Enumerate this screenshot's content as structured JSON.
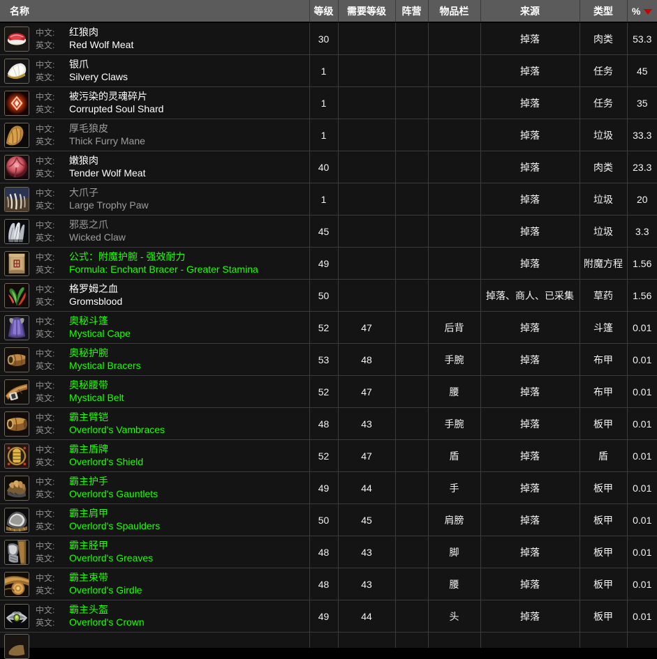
{
  "table": {
    "columns": [
      {
        "key": "name",
        "label": "名称"
      },
      {
        "key": "level",
        "label": "等级"
      },
      {
        "key": "req",
        "label": "需要等级"
      },
      {
        "key": "faction",
        "label": "阵营"
      },
      {
        "key": "slot",
        "label": "物品栏"
      },
      {
        "key": "source",
        "label": "来源"
      },
      {
        "key": "type",
        "label": "类型"
      },
      {
        "key": "pct",
        "label": "%"
      }
    ],
    "sort": {
      "column": "%",
      "direction": "desc",
      "caret_color": "#cc0000"
    },
    "labels": {
      "zh": "中文:",
      "en": "英文:"
    },
    "quality_colors": {
      "common": "#ffffff",
      "poor": "#9d9d9d",
      "uncommon": "#1eff00"
    },
    "rows": [
      {
        "zh": "红狼肉",
        "en": "Red Wolf Meat",
        "quality": "common",
        "level": "30",
        "req": "",
        "faction": "",
        "slot": "",
        "source": "掉落",
        "type": "肉类",
        "pct": "53.3",
        "icon": "red-wolf-meat-icon"
      },
      {
        "zh": "银爪",
        "en": "Silvery Claws",
        "quality": "common",
        "level": "1",
        "req": "",
        "faction": "",
        "slot": "",
        "source": "掉落",
        "type": "任务",
        "pct": "45",
        "icon": "silvery-claws-icon"
      },
      {
        "zh": "被污染的灵魂碎片",
        "en": "Corrupted Soul Shard",
        "quality": "common",
        "level": "1",
        "req": "",
        "faction": "",
        "slot": "",
        "source": "掉落",
        "type": "任务",
        "pct": "35",
        "icon": "corrupted-soul-shard-icon"
      },
      {
        "zh": "厚毛狼皮",
        "en": "Thick Furry Mane",
        "quality": "poor",
        "level": "1",
        "req": "",
        "faction": "",
        "slot": "",
        "source": "掉落",
        "type": "垃圾",
        "pct": "33.3",
        "icon": "thick-furry-mane-icon"
      },
      {
        "zh": "嫩狼肉",
        "en": "Tender Wolf Meat",
        "quality": "common",
        "level": "40",
        "req": "",
        "faction": "",
        "slot": "",
        "source": "掉落",
        "type": "肉类",
        "pct": "23.3",
        "icon": "tender-wolf-meat-icon"
      },
      {
        "zh": "大爪子",
        "en": "Large Trophy Paw",
        "quality": "poor",
        "level": "1",
        "req": "",
        "faction": "",
        "slot": "",
        "source": "掉落",
        "type": "垃圾",
        "pct": "20",
        "icon": "large-trophy-paw-icon"
      },
      {
        "zh": "邪恶之爪",
        "en": "Wicked Claw",
        "quality": "poor",
        "level": "45",
        "req": "",
        "faction": "",
        "slot": "",
        "source": "掉落",
        "type": "垃圾",
        "pct": "3.3",
        "icon": "wicked-claw-icon"
      },
      {
        "zh": "公式：附魔护腕 - 强效耐力",
        "en": "Formula: Enchant Bracer - Greater Stamina",
        "quality": "uncommon",
        "level": "49",
        "req": "",
        "faction": "",
        "slot": "",
        "source": "掉落",
        "type": "附魔方程",
        "pct": "1.56",
        "icon": "formula-scroll-icon"
      },
      {
        "zh": "格罗姆之血",
        "en": "Gromsblood",
        "quality": "common",
        "level": "50",
        "req": "",
        "faction": "",
        "slot": "",
        "source": "掉落、商人、已采集",
        "type": "草药",
        "pct": "1.56",
        "icon": "gromsblood-icon"
      },
      {
        "zh": "奥秘斗篷",
        "en": "Mystical Cape",
        "quality": "uncommon",
        "level": "52",
        "req": "47",
        "faction": "",
        "slot": "后背",
        "source": "掉落",
        "type": "斗篷",
        "pct": "0.01",
        "icon": "mystical-cape-icon"
      },
      {
        "zh": "奥秘护腕",
        "en": "Mystical Bracers",
        "quality": "uncommon",
        "level": "53",
        "req": "48",
        "faction": "",
        "slot": "手腕",
        "source": "掉落",
        "type": "布甲",
        "pct": "0.01",
        "icon": "mystical-bracers-icon"
      },
      {
        "zh": "奥秘腰带",
        "en": "Mystical Belt",
        "quality": "uncommon",
        "level": "52",
        "req": "47",
        "faction": "",
        "slot": "腰",
        "source": "掉落",
        "type": "布甲",
        "pct": "0.01",
        "icon": "mystical-belt-icon"
      },
      {
        "zh": "霸主臂铠",
        "en": "Overlord's Vambraces",
        "quality": "uncommon",
        "level": "48",
        "req": "43",
        "faction": "",
        "slot": "手腕",
        "source": "掉落",
        "type": "板甲",
        "pct": "0.01",
        "icon": "overlords-vambraces-icon"
      },
      {
        "zh": "霸主盾牌",
        "en": "Overlord's Shield",
        "quality": "uncommon",
        "level": "52",
        "req": "47",
        "faction": "",
        "slot": "盾",
        "source": "掉落",
        "type": "盾",
        "pct": "0.01",
        "icon": "overlords-shield-icon"
      },
      {
        "zh": "霸主护手",
        "en": "Overlord's Gauntlets",
        "quality": "uncommon",
        "level": "49",
        "req": "44",
        "faction": "",
        "slot": "手",
        "source": "掉落",
        "type": "板甲",
        "pct": "0.01",
        "icon": "overlords-gauntlets-icon"
      },
      {
        "zh": "霸主肩甲",
        "en": "Overlord's Spaulders",
        "quality": "uncommon",
        "level": "50",
        "req": "45",
        "faction": "",
        "slot": "肩膀",
        "source": "掉落",
        "type": "板甲",
        "pct": "0.01",
        "icon": "overlords-spaulders-icon"
      },
      {
        "zh": "霸主胫甲",
        "en": "Overlord's Greaves",
        "quality": "uncommon",
        "level": "48",
        "req": "43",
        "faction": "",
        "slot": "脚",
        "source": "掉落",
        "type": "板甲",
        "pct": "0.01",
        "icon": "overlords-greaves-icon"
      },
      {
        "zh": "霸主束带",
        "en": "Overlord's Girdle",
        "quality": "uncommon",
        "level": "48",
        "req": "43",
        "faction": "",
        "slot": "腰",
        "source": "掉落",
        "type": "板甲",
        "pct": "0.01",
        "icon": "overlords-girdle-icon"
      },
      {
        "zh": "霸主头盔",
        "en": "Overlord's Crown",
        "quality": "uncommon",
        "level": "49",
        "req": "44",
        "faction": "",
        "slot": "头",
        "source": "掉落",
        "type": "板甲",
        "pct": "0.01",
        "icon": "overlords-crown-icon"
      }
    ]
  }
}
